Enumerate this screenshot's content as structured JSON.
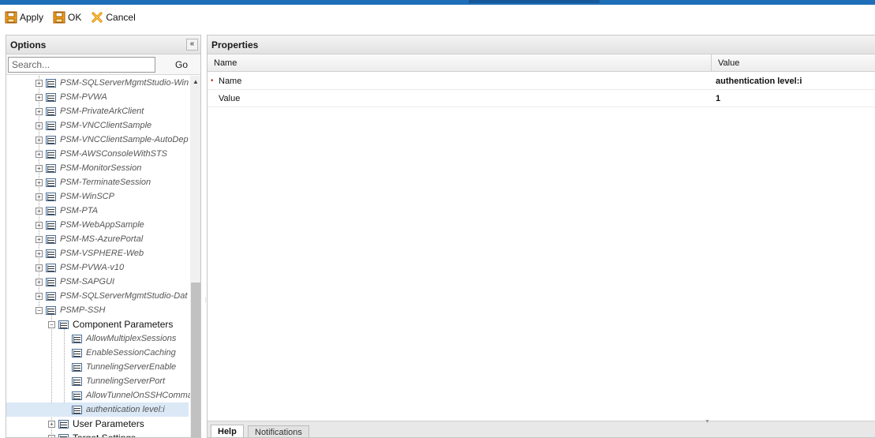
{
  "toolbar": {
    "apply_label": "Apply",
    "ok_label": "OK",
    "cancel_label": "Cancel"
  },
  "options_panel": {
    "title": "Options",
    "collapse_glyph": "«",
    "search": {
      "placeholder": "Search...",
      "value": ""
    },
    "go_label": "Go",
    "tree": [
      "PSM-SQLServerMgmtStudio-Win",
      "PSM-PVWA",
      "PSM-PrivateArkClient",
      "PSM-VNCClientSample",
      "PSM-VNCClientSample-AutoDep",
      "PSM-AWSConsoleWithSTS",
      "PSM-MonitorSession",
      "PSM-TerminateSession",
      "PSM-WinSCP",
      "PSM-PTA",
      "PSM-WebAppSample",
      "PSM-MS-AzurePortal",
      "PSM-VSPHERE-Web",
      "PSM-PVWA-v10",
      "PSM-SAPGUI",
      "PSM-SQLServerMgmtStudio-Dat",
      "PSMP-SSH"
    ],
    "component_parameters_label": "Component Parameters",
    "component_parameters": [
      "AllowMultiplexSessions",
      "EnableSessionCaching",
      "TunnelingServerEnable",
      "TunnelingServerPort",
      "AllowTunnelOnSSHComma",
      "authentication level:i"
    ],
    "user_parameters_label": "User Parameters",
    "target_settings_label": "Target Settings"
  },
  "properties_panel": {
    "title": "Properties",
    "columns": {
      "name": "Name",
      "value": "Value"
    },
    "rows": [
      {
        "name": "Name",
        "value": "authentication level:i",
        "required": "•"
      },
      {
        "name": "Value",
        "value": "1",
        "required": ""
      }
    ]
  },
  "bottom_tabs": {
    "help": "Help",
    "notifications": "Notifications"
  },
  "colors": {
    "accent": "#1f6fb8",
    "selection": "#dbe8f6"
  },
  "icons": [
    "save-icon",
    "save-ok-icon",
    "cancel-icon",
    "expand-icon",
    "collapse-icon",
    "component-icon"
  ]
}
